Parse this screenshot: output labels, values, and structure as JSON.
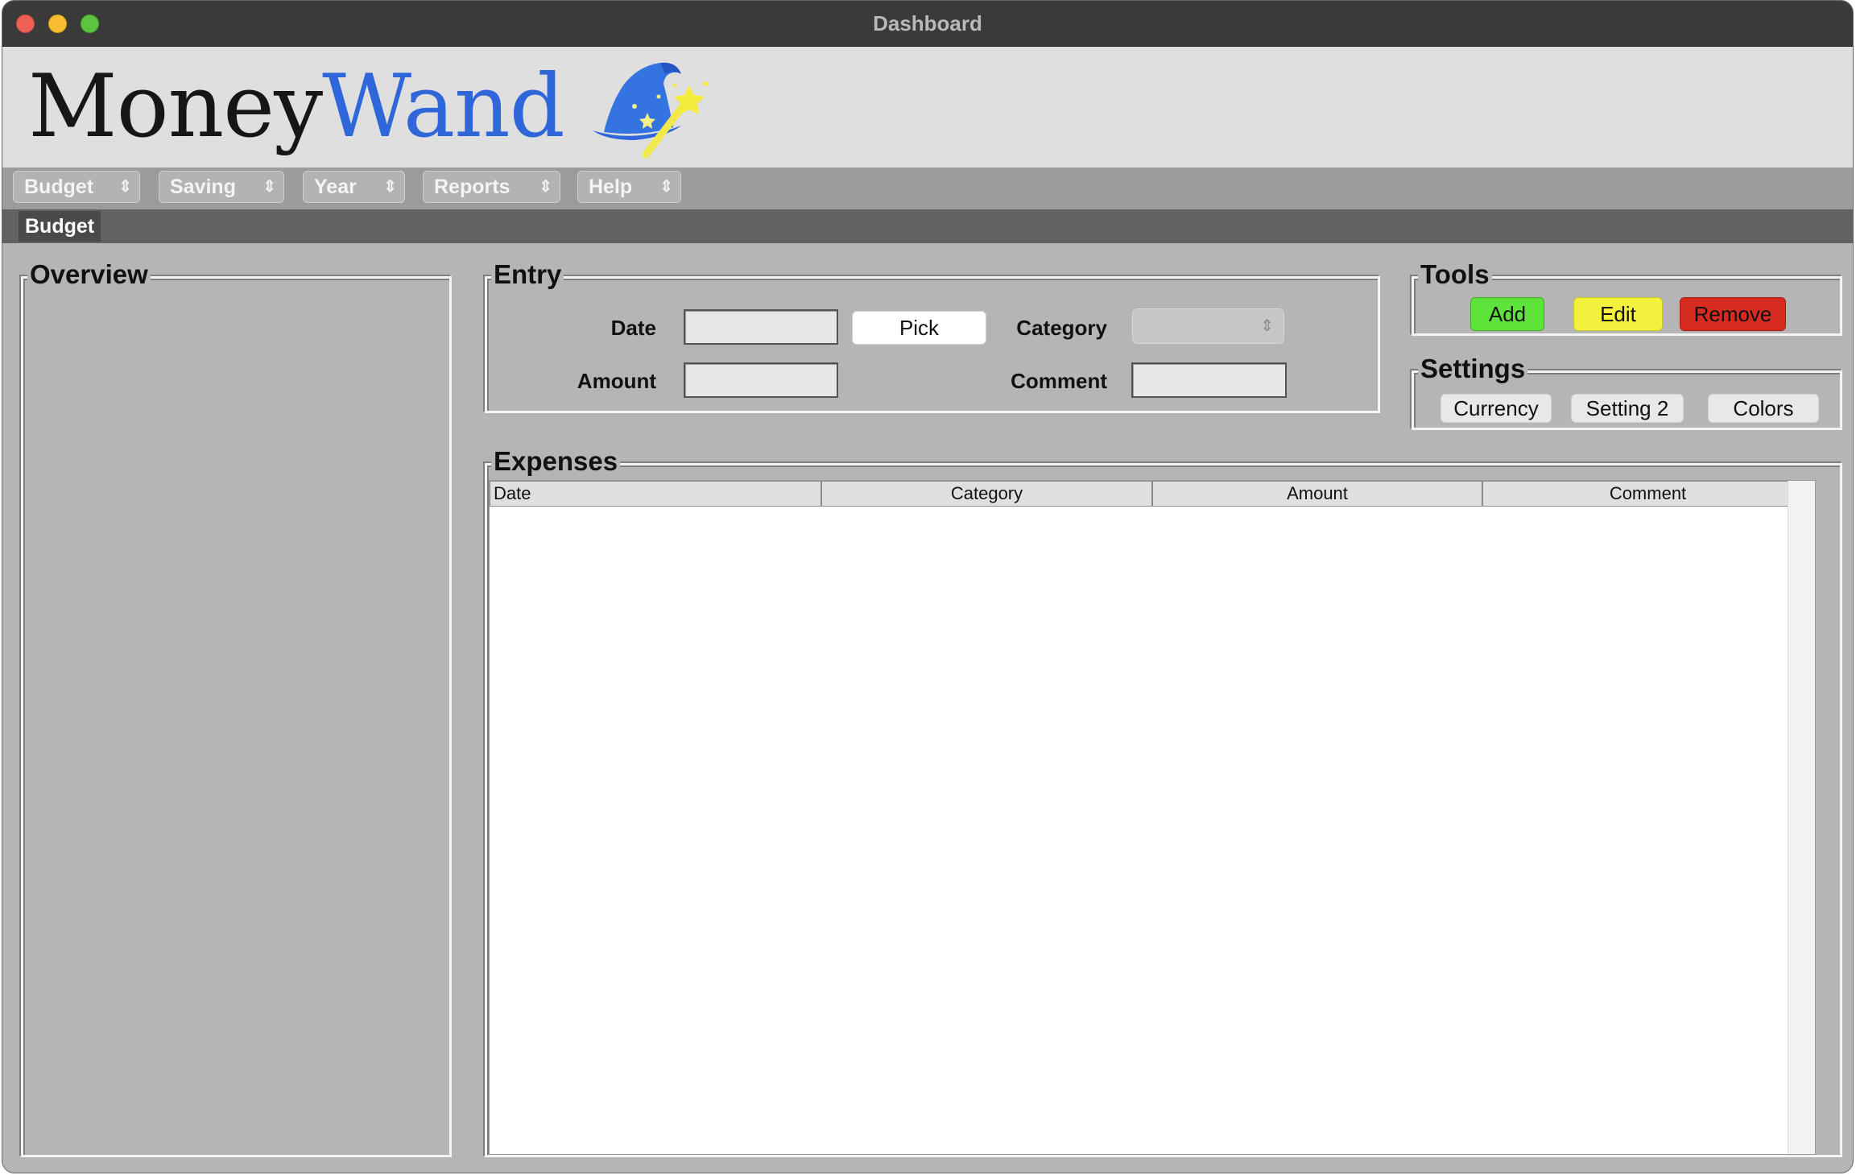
{
  "window": {
    "title": "Dashboard"
  },
  "brand": {
    "name_part1": "Money",
    "name_part2": "Wand"
  },
  "menus": [
    {
      "label": "Budget"
    },
    {
      "label": "Saving"
    },
    {
      "label": "Year"
    },
    {
      "label": "Reports"
    },
    {
      "label": "Help"
    }
  ],
  "tabs": {
    "active": "Budget"
  },
  "overview": {
    "title": "Overview"
  },
  "entry": {
    "title": "Entry",
    "date_label": "Date",
    "date_value": "",
    "pick_label": "Pick",
    "category_label": "Category",
    "category_value": "",
    "amount_label": "Amount",
    "amount_value": "",
    "comment_label": "Comment",
    "comment_value": ""
  },
  "tools": {
    "title": "Tools",
    "add_label": "Add",
    "edit_label": "Edit",
    "remove_label": "Remove",
    "colors": {
      "add": "#5ee33a",
      "edit": "#f4f03e",
      "remove": "#d62b1f"
    }
  },
  "settings": {
    "title": "Settings",
    "currency_label": "Currency",
    "setting2_label": "Setting 2",
    "colors_label": "Colors"
  },
  "expenses": {
    "title": "Expenses",
    "columns": [
      "Date",
      "Category",
      "Amount",
      "Comment"
    ],
    "rows": []
  },
  "icons": {
    "logo": "wizard-hat-with-wand-icon",
    "menu_indicator": "up-down-chevron-icon"
  }
}
